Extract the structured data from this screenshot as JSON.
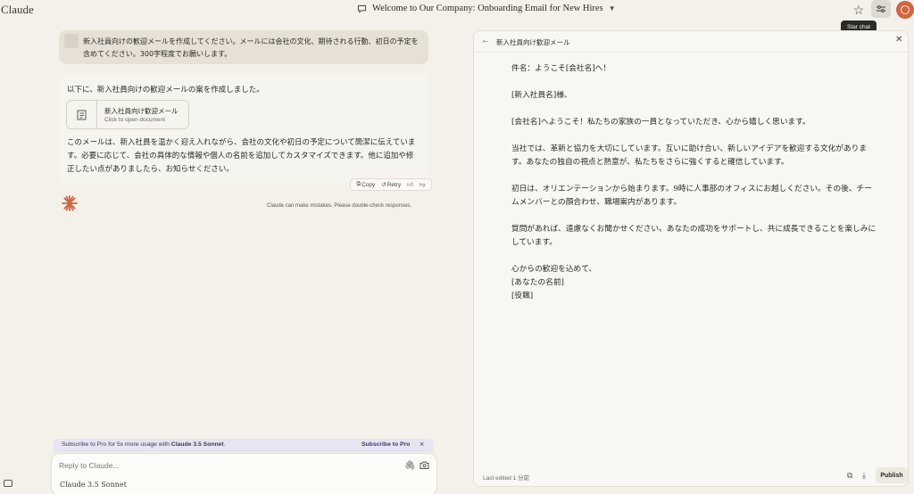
{
  "app": {
    "brand": "Claude"
  },
  "header": {
    "title": "Welcome to Our Company: Onboarding Email for New Hires",
    "tooltip": "Star chat"
  },
  "user_message": {
    "text": "新入社員向けの歓迎メールを作成してください。メールには会社の文化、期待される行動、初日の予定を含めてください。300字程度でお願いします。"
  },
  "assistant_message": {
    "intro": "以下に、新入社員向けの歓迎メールの案を作成しました。",
    "doc_card": {
      "title": "新入社員向け歓迎メール",
      "subtitle": "Click to open document"
    },
    "body": "このメールは、新入社員を温かく迎え入れながら、会社の文化や初日の予定について簡潔に伝えています。必要に応じて、会社の具体的な情報や個人の名前を追加してカスタマイズできます。他に追加や修正したい点がありましたら、お知らせください。",
    "actions": {
      "copy": "Copy",
      "retry": "Retry"
    }
  },
  "disclaimer": "Claude can make mistakes. Please double-check responses.",
  "promo": {
    "text_prefix": "Subscribe to Pro for 5x more usage with ",
    "text_bold": "Claude 3.5 Sonnet",
    "text_suffix": ".",
    "link": "Subscribe to Pro"
  },
  "composer": {
    "placeholder": "Reply to Claude...",
    "model": "Claude 3.5 Sonnet"
  },
  "artifact": {
    "title": "新入社員向け歓迎メール",
    "subject": "件名：ようこそ[会社名]へ！",
    "greeting": "[新入社員名]様、",
    "p1": "[会社名]へようこそ！私たちの家族の一員となっていただき、心から嬉しく思います。",
    "p2": "当社では、革新と協力を大切にしています。互いに助け合い、新しいアイデアを歓迎する文化があります。あなたの独自の視点と熱意が、私たちをさらに強くすると確信しています。",
    "p3": "初日は、オリエンテーションから始まります。9時に人事部のオフィスにお越しください。その後、チームメンバーとの顔合わせ、職場案内があります。",
    "p4": "質問があれば、遠慮なくお聞かせください。あなたの成功をサポートし、共に成長できることを楽しみにしています。",
    "closing": "心からの歓迎を込めて、",
    "sign_name": "[あなたの名前]",
    "sign_title": "[役職]",
    "last_edited": "Last edited 1 分前",
    "publish": "Publish"
  },
  "colors": {
    "accent": "#d3653f",
    "background": "#f3f1ea",
    "promo_bg": "#e8e4f2"
  }
}
